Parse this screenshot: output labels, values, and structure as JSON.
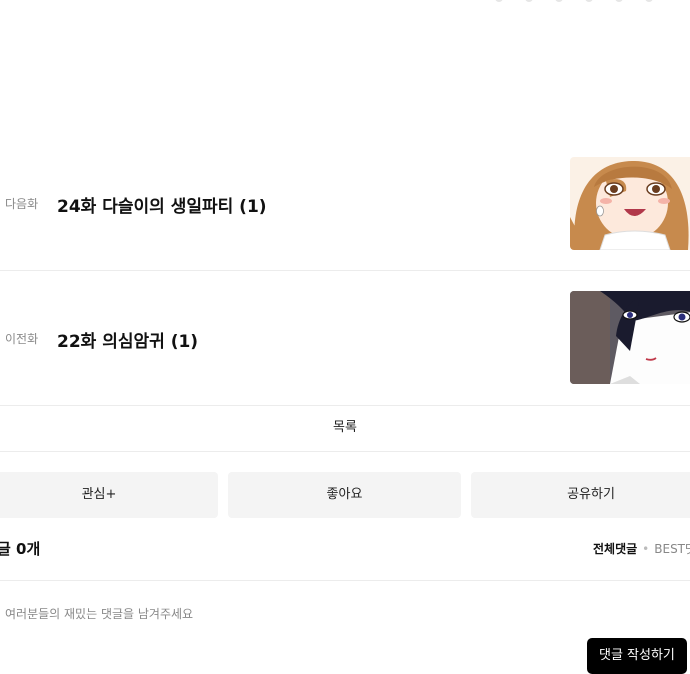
{
  "episodes": {
    "next": {
      "kind": "다음화",
      "title": "24화 다슬이의 생일파티 (1)",
      "thumb": "smiling-girl-thumbnail"
    },
    "prev": {
      "kind": "이전화",
      "title": "22화 의심암귀 (1)",
      "thumb": "dark-hair-boy-thumbnail"
    }
  },
  "list_button": "목록",
  "actions": {
    "interest": "관심+",
    "like": "좋아요",
    "share": "공유하기"
  },
  "comments": {
    "count_label": "글 0개",
    "sort_all": "전체댓글",
    "sort_best": "BEST댓",
    "placeholder": "여러분들의 재밌는 댓글을 남겨주세요",
    "write_button": "댓글 작성하기"
  }
}
